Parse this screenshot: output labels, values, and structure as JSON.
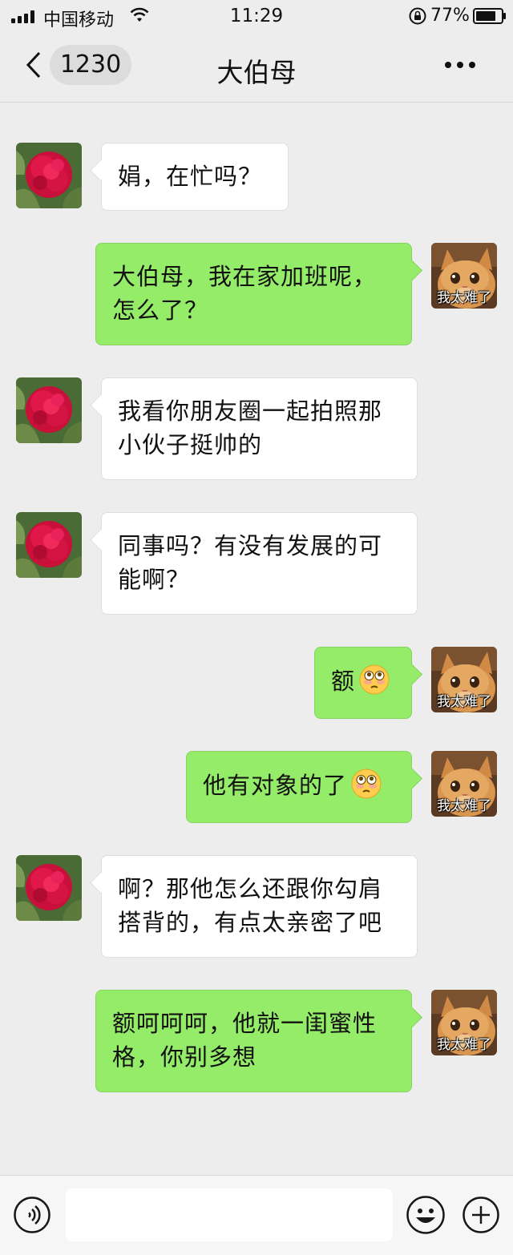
{
  "status_bar": {
    "carrier": "中国移动",
    "time": "11:29",
    "battery_percent": "77%"
  },
  "nav": {
    "unread_count": "1230",
    "title": "大伯母"
  },
  "cat_avatar_caption": "我太难了",
  "messages": [
    {
      "side": "left",
      "line1": "娟，在忙吗？",
      "line2": ""
    },
    {
      "side": "right",
      "line1": "大伯母，我在家加班呢，",
      "line2": "怎么了？"
    },
    {
      "side": "left",
      "line1": "我看你朋友圈一起拍照那",
      "line2": "小伙子挺帅的"
    },
    {
      "side": "left",
      "line1": "同事吗？有没有发展的可",
      "line2": "能啊？"
    },
    {
      "side": "right",
      "text": "额",
      "emoji": "flushed-face"
    },
    {
      "side": "right",
      "text": "他有对象的了",
      "emoji": "flushed-face"
    },
    {
      "side": "left",
      "line1": "啊？那他怎么还跟你勾肩",
      "line2": "搭背的，有点太亲密了吧"
    },
    {
      "side": "right",
      "line1": "额呵呵呵，他就一闺蜜性",
      "line2": "格，你别多想"
    }
  ],
  "input_bar": {
    "placeholder": ""
  },
  "colors": {
    "background": "#ededed",
    "sent_bubble": "#95ec69",
    "received_bubble": "#ffffff"
  }
}
